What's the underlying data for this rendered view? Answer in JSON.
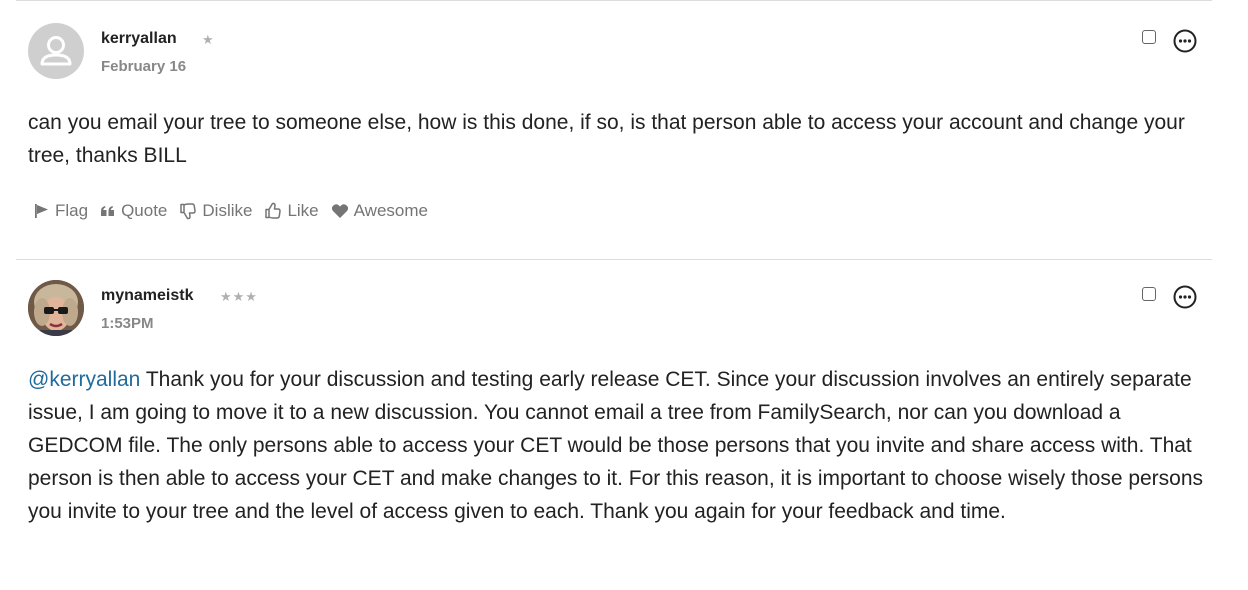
{
  "posts": [
    {
      "author": "kerryallan",
      "rank_stars": "★",
      "date": "February 16",
      "body": "can you email your tree to someone else, how is this done, if so, is that person able to access your account and change your tree, thanks BILL",
      "reactions": [
        "Flag",
        "Quote",
        "Dislike",
        "Like",
        "Awesome"
      ]
    },
    {
      "author": "mynameistk",
      "rank_stars": "★★★",
      "date": "1:53PM",
      "mention": "@kerryallan",
      "body": " Thank you for your discussion and testing early release CET. Since your discussion involves an entirely separate issue, I am going to move it to a new discussion. You cannot email a tree from FamilySearch, nor can you download a GEDCOM file. The only persons able to access your CET would be those persons that you invite and share access with. That person is then able to access your CET and make changes to it. For this reason, it is important to choose wisely those persons you invite to your tree and the level of access given to each. Thank you again for your feedback and time."
    }
  ],
  "icons": {
    "avatar_placeholder": "user-silhouette-icon",
    "more": "ellipsis-circle-icon",
    "flag": "flag-icon",
    "quote": "quote-icon",
    "dislike": "thumbs-down-icon",
    "like": "thumbs-up-icon",
    "awesome": "heart-icon"
  },
  "colors": {
    "mention": "#1f6b9d",
    "meta_text": "#888888",
    "reaction_text": "#757575"
  }
}
